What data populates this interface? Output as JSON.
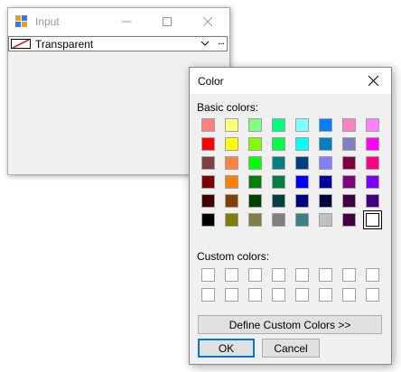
{
  "input_window": {
    "title": "Input",
    "combo_value": "Transparent",
    "ellipsis_label": "..."
  },
  "color_dialog": {
    "title": "Color",
    "basic_colors_label": "Basic colors:",
    "custom_colors_label": "Custom colors:",
    "basic_colors": [
      [
        "#ff8080",
        "#ffff80",
        "#80ff80",
        "#00ff80",
        "#80ffff",
        "#0080ff",
        "#ff80c0",
        "#ff80ff"
      ],
      [
        "#ff0000",
        "#ffff00",
        "#80ff00",
        "#00ff40",
        "#00ffff",
        "#0080c0",
        "#8080c0",
        "#ff00ff"
      ],
      [
        "#804040",
        "#ff8040",
        "#00ff00",
        "#008080",
        "#004080",
        "#8080ff",
        "#800040",
        "#ff0080"
      ],
      [
        "#800000",
        "#ff8000",
        "#008000",
        "#008040",
        "#0000ff",
        "#0000a0",
        "#800080",
        "#8000ff"
      ],
      [
        "#400000",
        "#804000",
        "#004000",
        "#004040",
        "#000080",
        "#000040",
        "#400040",
        "#400080"
      ],
      [
        "#000000",
        "#808000",
        "#808040",
        "#808080",
        "#408080",
        "#c0c0c0",
        "#400040",
        "#ffffff"
      ]
    ],
    "selected_color": "#ffffff",
    "define_custom_label": "Define Custom Colors >>",
    "ok_label": "OK",
    "cancel_label": "Cancel"
  }
}
